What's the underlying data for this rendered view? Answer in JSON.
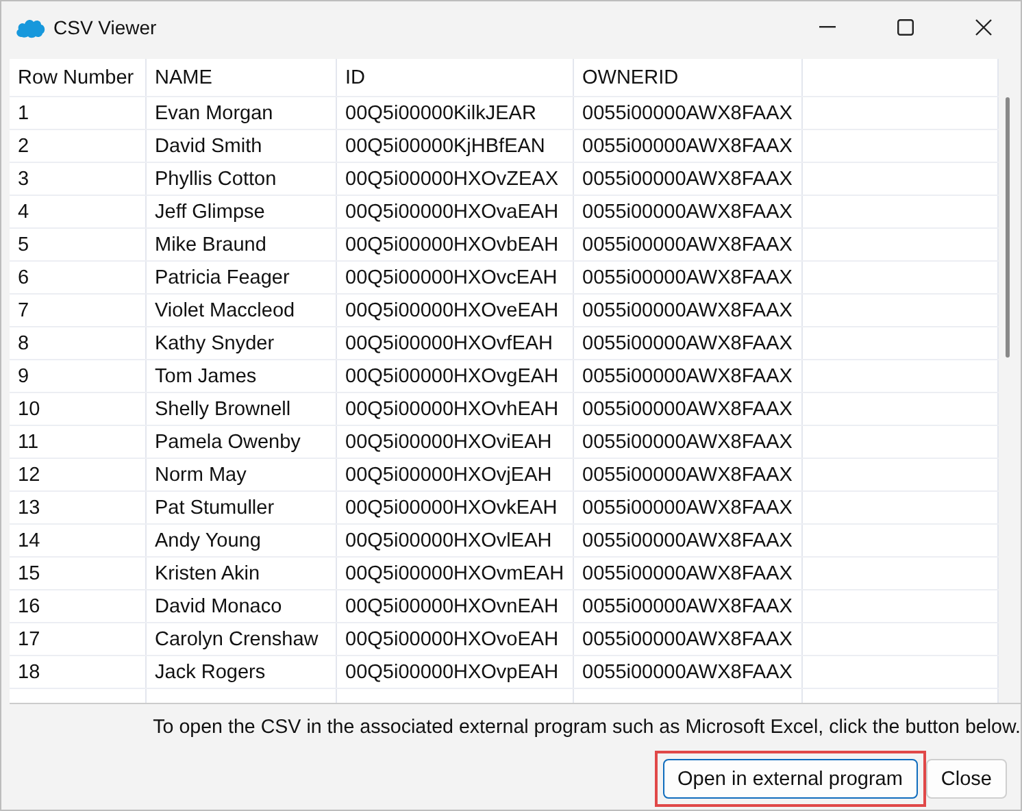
{
  "window": {
    "title": "CSV Viewer"
  },
  "table": {
    "columns": [
      "Row Number",
      "NAME",
      "ID",
      "OWNERID"
    ],
    "rows": [
      [
        "1",
        "Evan Morgan",
        "00Q5i00000KilkJEAR",
        "0055i00000AWX8FAAX"
      ],
      [
        "2",
        "David Smith",
        "00Q5i00000KjHBfEAN",
        "0055i00000AWX8FAAX"
      ],
      [
        "3",
        "Phyllis Cotton",
        "00Q5i00000HXOvZEAX",
        "0055i00000AWX8FAAX"
      ],
      [
        "4",
        "Jeff Glimpse",
        "00Q5i00000HXOvaEAH",
        "0055i00000AWX8FAAX"
      ],
      [
        "5",
        "Mike Braund",
        "00Q5i00000HXOvbEAH",
        "0055i00000AWX8FAAX"
      ],
      [
        "6",
        "Patricia Feager",
        "00Q5i00000HXOvcEAH",
        "0055i00000AWX8FAAX"
      ],
      [
        "7",
        "Violet Maccleod",
        "00Q5i00000HXOveEAH",
        "0055i00000AWX8FAAX"
      ],
      [
        "8",
        "Kathy Snyder",
        "00Q5i00000HXOvfEAH",
        "0055i00000AWX8FAAX"
      ],
      [
        "9",
        "Tom James",
        "00Q5i00000HXOvgEAH",
        "0055i00000AWX8FAAX"
      ],
      [
        "10",
        "Shelly Brownell",
        "00Q5i00000HXOvhEAH",
        "0055i00000AWX8FAAX"
      ],
      [
        "11",
        "Pamela Owenby",
        "00Q5i00000HXOviEAH",
        "0055i00000AWX8FAAX"
      ],
      [
        "12",
        "Norm May",
        "00Q5i00000HXOvjEAH",
        "0055i00000AWX8FAAX"
      ],
      [
        "13",
        "Pat Stumuller",
        "00Q5i00000HXOvkEAH",
        "0055i00000AWX8FAAX"
      ],
      [
        "14",
        "Andy Young",
        "00Q5i00000HXOvlEAH",
        "0055i00000AWX8FAAX"
      ],
      [
        "15",
        "Kristen Akin",
        "00Q5i00000HXOvmEAH",
        "0055i00000AWX8FAAX"
      ],
      [
        "16",
        "David Monaco",
        "00Q5i00000HXOvnEAH",
        "0055i00000AWX8FAAX"
      ],
      [
        "17",
        "Carolyn Crenshaw",
        "00Q5i00000HXOvoEAH",
        "0055i00000AWX8FAAX"
      ],
      [
        "18",
        "Jack Rogers",
        "00Q5i00000HXOvpEAH",
        "0055i00000AWX8FAAX"
      ]
    ]
  },
  "message": "To open the CSV in the associated external program such as Microsoft Excel, click the button below.",
  "buttons": [
    {
      "label": "Open in external program",
      "highlighted": true
    },
    {
      "label": "Close",
      "highlighted": false
    }
  ]
}
